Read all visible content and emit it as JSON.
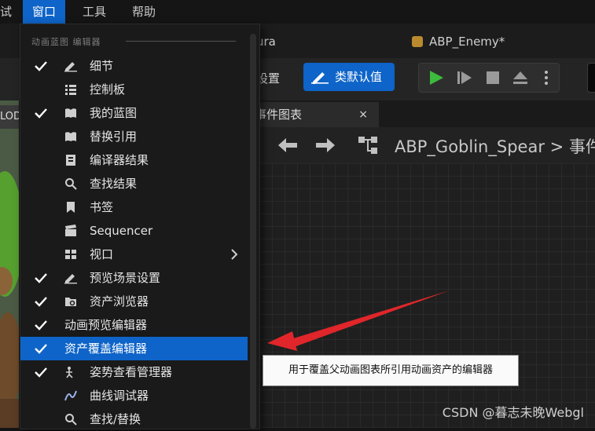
{
  "menubar": {
    "items": [
      {
        "label": "试"
      },
      {
        "label": "窗口"
      },
      {
        "label": "工具"
      },
      {
        "label": "帮助"
      }
    ]
  },
  "tabs": [
    {
      "label": "ura"
    },
    {
      "label": "ABP_Enemy*"
    }
  ],
  "toolbar": {
    "settings_label": "设置",
    "class_defaults_label": "类默认值"
  },
  "viewport": {
    "lod_label": "LOD"
  },
  "graph": {
    "tab_label": "事件图表",
    "tab_close": "×",
    "breadcrumb": {
      "asset": "ABP_Goblin_Spear",
      "separator": ">",
      "current": "事件"
    }
  },
  "window_menu": {
    "section_title": "动画蓝图 编辑器",
    "items": [
      {
        "label": "细节",
        "checked": true,
        "icon": "pencil-icon"
      },
      {
        "label": "控制板",
        "checked": false,
        "icon": "list-icon"
      },
      {
        "label": "我的蓝图",
        "checked": true,
        "icon": "book-icon"
      },
      {
        "label": "替换引用",
        "checked": false,
        "icon": "book-icon"
      },
      {
        "label": "编译器结果",
        "checked": false,
        "icon": "compile-icon"
      },
      {
        "label": "查找结果",
        "checked": false,
        "icon": "search-icon"
      },
      {
        "label": "书签",
        "checked": false,
        "icon": "bookmark-icon"
      },
      {
        "label": "Sequencer",
        "checked": false,
        "icon": "clapper-icon"
      },
      {
        "label": "视口",
        "checked": false,
        "icon": "viewport-icon",
        "submenu": true
      },
      {
        "label": "预览场景设置",
        "checked": true,
        "icon": "pencil-icon"
      },
      {
        "label": "资产浏览器",
        "checked": true,
        "icon": "folder-search-icon"
      },
      {
        "label": "动画预览编辑器",
        "checked": true,
        "icon": ""
      },
      {
        "label": "资产覆盖编辑器",
        "checked": true,
        "icon": "",
        "selected": true
      },
      {
        "label": "姿势查看管理器",
        "checked": true,
        "icon": "pose-icon"
      },
      {
        "label": "曲线调试器",
        "checked": false,
        "icon": "curve-icon"
      },
      {
        "label": "查找/替换",
        "checked": false,
        "icon": "search-icon"
      }
    ]
  },
  "tooltip": {
    "text": "用于覆盖父动画图表所引用动画资产的编辑器"
  },
  "watermark": "CSDN @暮志未晚Webgl",
  "colors": {
    "accent": "#0e64c8",
    "play_green": "#3dbb3d",
    "annotation_red": "#e0262a"
  }
}
